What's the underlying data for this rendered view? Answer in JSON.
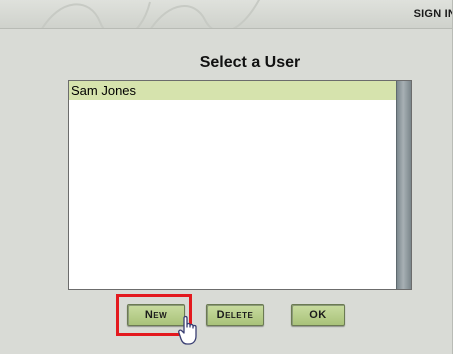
{
  "header": {
    "sign_in_label": "SIGN IN"
  },
  "dialog": {
    "title": "Select a User",
    "users": [
      "Sam Jones"
    ],
    "selected_index": 0
  },
  "buttons": {
    "new_label": "New",
    "delete_label": "Delete",
    "ok_label": "OK"
  },
  "colors": {
    "panel_background": "#d9dbd6",
    "selection": "#d6e3ad",
    "button": "#b7cd8a",
    "highlight_box": "#e3191e",
    "scrollbar": "#8f9aa0"
  },
  "icons": [
    "hand-pointer-icon"
  ]
}
